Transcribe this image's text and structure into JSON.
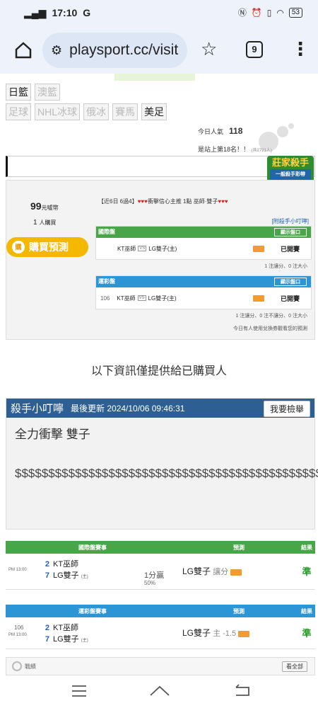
{
  "status": {
    "time": "17:10",
    "carrier": "G",
    "battery": "53"
  },
  "browser": {
    "url": "playsport.cc/visit",
    "tab_count": "9"
  },
  "tags_row1": [
    "日籃",
    "澳籃"
  ],
  "tags_row2": [
    "足球",
    "NHL冰球",
    "俄冰",
    "賽馬",
    "美足"
  ],
  "stats": {
    "pop_label": "今日人氣",
    "pop_value": "118",
    "rank_text": "是站上第18名！！",
    "rank_small": "(共2791人)"
  },
  "badge": {
    "title": "莊家殺手",
    "subtitle": "一般殺手彩帶"
  },
  "pick": {
    "price": "99",
    "price_unit": "元噓幣",
    "buyers": "1",
    "buyers_unit": "人購買",
    "buy_label": "購買預測",
    "buy_icon": "購",
    "headline_prefix": "【近6日 6過4】",
    "headline_mid": "衝擊信心主推 1點 巫師·雙子",
    "tip_link": "[附殺手小叮嚀]",
    "intl_title": "國際盤",
    "lottery_title": "運彩盤",
    "show_label": "顯示盤口",
    "intl_match": {
      "home": "KT巫師",
      "vs": "VS",
      "away": "LG雙子(主)",
      "status": "已開賽"
    },
    "intl_note": "1 注讓分、0 注大小",
    "lottery_match": {
      "no": "106",
      "home": "KT巫師",
      "vs": "VS",
      "away": "LG雙子(主)",
      "status": "已開賽"
    },
    "lottery_note": "1 注讓分、0 注不讓分、0 注大小",
    "swap_note": "今日有人使用兌換券觀看您的預測"
  },
  "only_buyers": "以下資訊僅提供給已購買人",
  "tip": {
    "header": "殺手小叮嚀",
    "updated": "最後更新 2024/10/06 09:46:31",
    "report": "我要檢舉",
    "title": "全力衝擊 雙子",
    "body": "$$$$$$$$$$$$$$$$$$$$$$$$$$$$$$$$$$$$$$$$$$$$$$$$$$$$$$$$$$$$$$$$$$"
  },
  "intl_table": {
    "headers": [
      "國際盤賽事",
      "預測",
      "結果"
    ],
    "time": "PM 13:00",
    "score_home": "2",
    "team_home": "KT巫師",
    "score_away": "7",
    "team_away": "LG雙子",
    "home_tag": "(主)",
    "line": "1分贏",
    "line_pct": "50%",
    "prediction": "LG雙子",
    "prediction_type": "讓分",
    "result": "準"
  },
  "lottery_table": {
    "headers": [
      "運彩盤賽事",
      "預測",
      "結果"
    ],
    "no": "106",
    "time": "PM 13:00",
    "score_home": "2",
    "team_home": "KT巫師",
    "score_away": "7",
    "team_away": "LG雙子",
    "home_tag": "(主)",
    "prediction": "LG雙子",
    "prediction_type": "主 -1.5",
    "result": "準"
  },
  "bottom": {
    "label": "戰績",
    "all": "看全部"
  },
  "colors": {
    "green": "#48a548",
    "blue": "#2c95d6",
    "navy": "#2d5f92",
    "gold": "#f5b800"
  }
}
